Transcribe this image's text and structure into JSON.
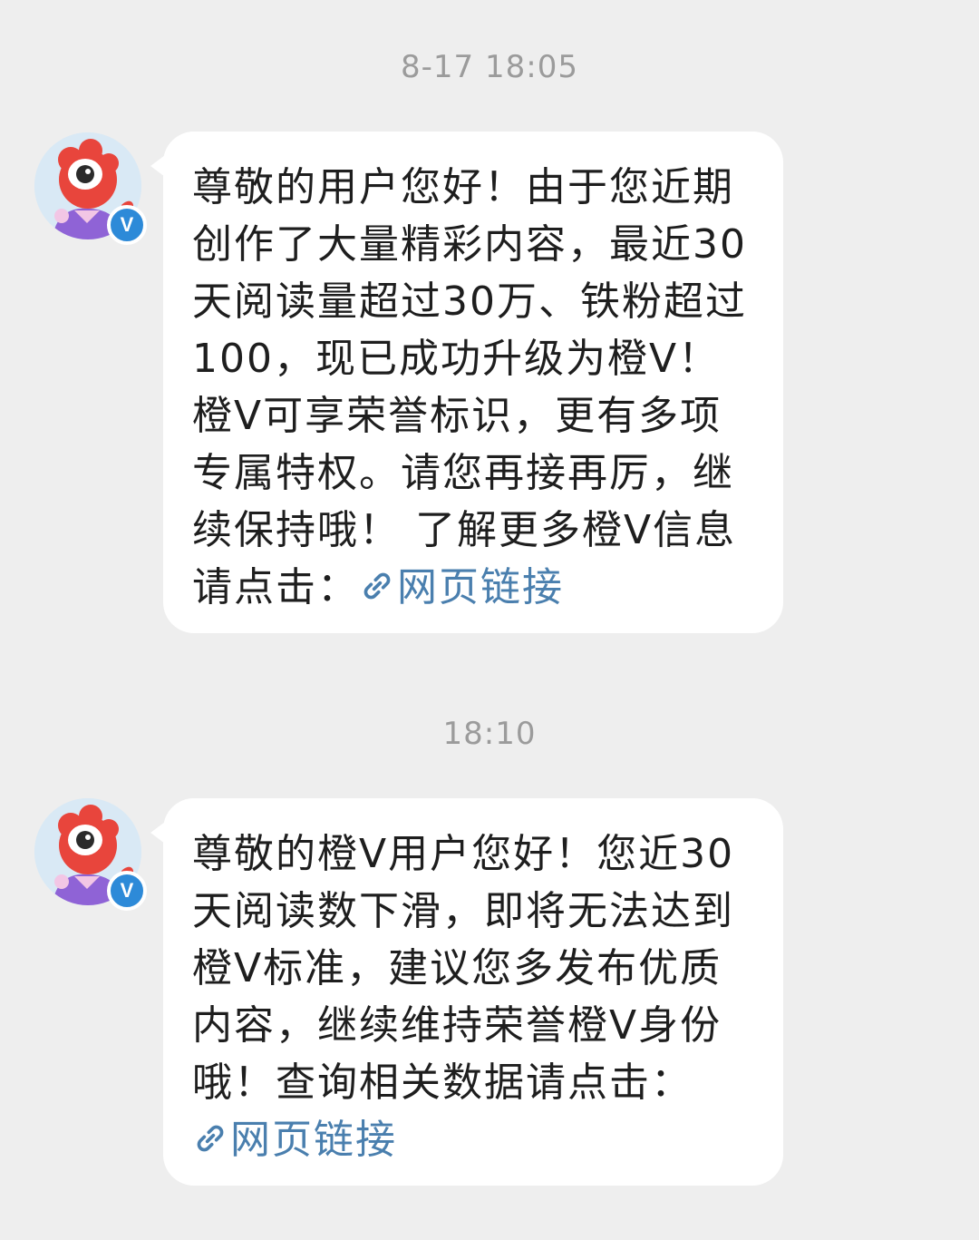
{
  "messages": [
    {
      "timestamp": "8-17 18:05",
      "sender_badge": "V",
      "text": "尊敬的用户您好！由于您近期创作了大量精彩内容，最近30天阅读量超过30万、铁粉超过100，现已成功升级为橙V！橙V可享荣誉标识，更有多项专属特权。请您再接再厉，继续保持哦！ 了解更多橙V信息请点击：",
      "link_icon": "link-icon",
      "link_label": "网页链接"
    },
    {
      "timestamp": "18:10",
      "sender_badge": "V",
      "text": "尊敬的橙V用户您好！您近30天阅读数下滑，即将无法达到橙V标准，建议您多发布优质内容，继续维持荣誉橙V身份哦！查询相关数据请点击：",
      "link_icon": "link-icon",
      "link_label": "网页链接"
    }
  ],
  "colors": {
    "background": "#eeeeee",
    "bubble": "#ffffff",
    "link": "#4a7fae",
    "timestamp": "#9b9b9b",
    "verified_badge": "#2d8ad8",
    "mascot": "#e8453c"
  }
}
